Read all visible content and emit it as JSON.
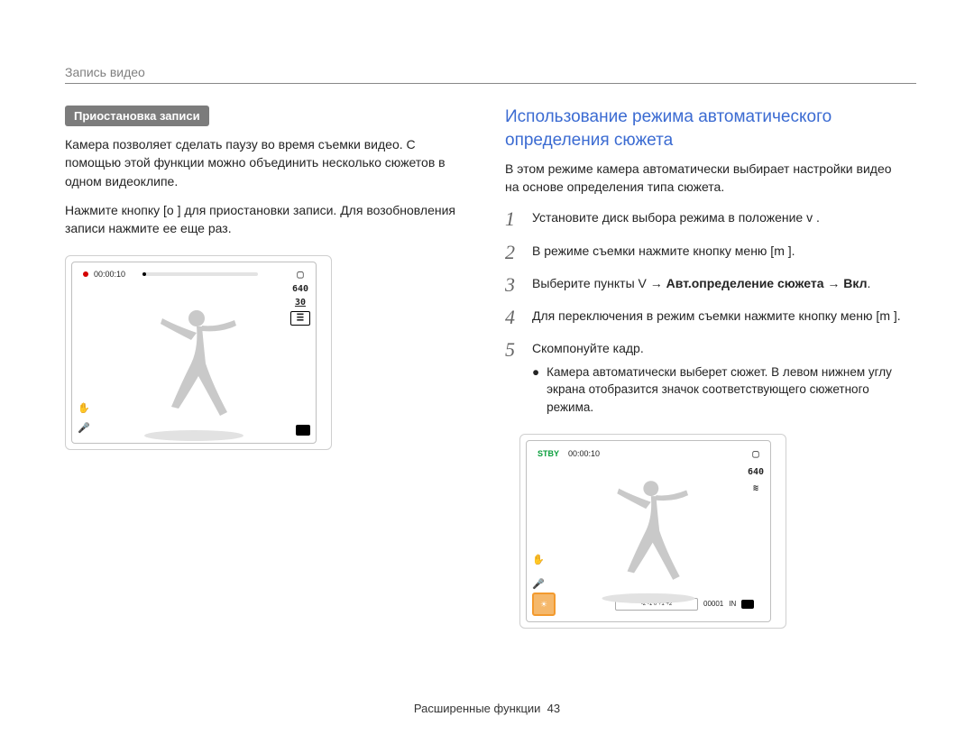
{
  "header": {
    "title": "Запись видео"
  },
  "left": {
    "subheading": "Приостановка записи",
    "para1": "Камера позволяет сделать паузу во время съемки видео. С помощью этой функции можно объединить несколько сюжетов в одном видеоклипе.",
    "para2": "Нажмите кнопку [o ] для приостановки записи. Для возобновления записи нажмите ее еще раз.",
    "viewfinder": {
      "time": "00:00:10",
      "res": "640",
      "fps": "30",
      "ratio_glyph": "⊞"
    }
  },
  "right": {
    "title": "Использование режима автоматического определения сюжета",
    "intro": "В этом режиме камера автоматически выбирает настройки видео на основе определения типа сюжета.",
    "steps": [
      {
        "n": "1",
        "text": "Установите диск выбора режима в положение v   ."
      },
      {
        "n": "2",
        "text": "В режиме съемки нажмите кнопку меню [m       ]."
      },
      {
        "n": "3",
        "prefix": "Выберите пункты V   → ",
        "bold1": "Авт.определение сюжета",
        "between": " → ",
        "bold2": "Вкл",
        "suffix": "."
      },
      {
        "n": "4",
        "text": "Для переключения в режим съемки нажмите кнопку меню [m       ]."
      },
      {
        "n": "5",
        "text": "Скомпонуйте кадр.",
        "bullet": "Камера автоматически выберет сюжет. В левом нижнем углу экрана отобразится значок соответствующего сюжетного режима."
      }
    ],
    "viewfinder2": {
      "stby": "STBY",
      "time": "00:00:10",
      "res": "640",
      "fps_glyph": "≋",
      "ev_scale": "-2 -1  0  +1  +2",
      "count": "00001",
      "iso": "IN"
    }
  },
  "footer": {
    "text": "Расширенные функции",
    "page": "43"
  }
}
